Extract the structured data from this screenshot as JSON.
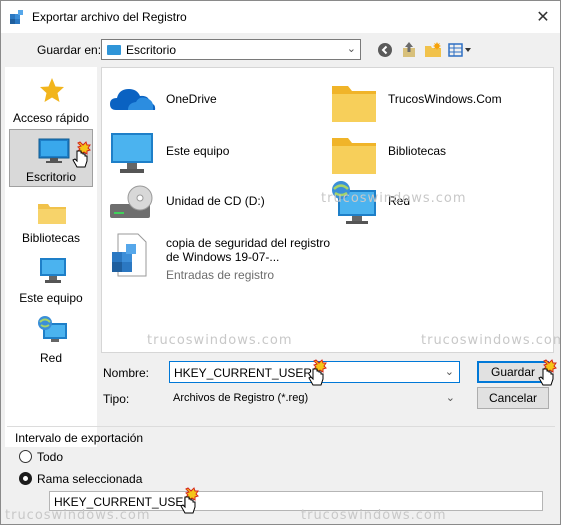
{
  "window": {
    "title": "Exportar archivo del Registro",
    "close": "✕"
  },
  "location": {
    "label": "Guardar en:",
    "value": "Escritorio"
  },
  "toolbar": {
    "icons": [
      "back-icon",
      "up-folder-icon",
      "new-folder-icon",
      "view-menu-icon"
    ]
  },
  "places": [
    {
      "label": "Acceso rápido",
      "icon": "star-icon"
    },
    {
      "label": "Escritorio",
      "icon": "desktop-icon",
      "selected": true
    },
    {
      "label": "Bibliotecas",
      "icon": "libraries-icon"
    },
    {
      "label": "Este equipo",
      "icon": "computer-icon"
    },
    {
      "label": "Red",
      "icon": "network-icon"
    }
  ],
  "files": [
    {
      "name": "OneDrive",
      "icon": "onedrive-icon"
    },
    {
      "name": "TrucosWindows.Com",
      "icon": "folder-icon"
    },
    {
      "name": "Este equipo",
      "icon": "computer-icon"
    },
    {
      "name": "Bibliotecas",
      "icon": "libraries-folder-icon"
    },
    {
      "name": "Unidad de CD (D:)",
      "icon": "cd-drive-icon"
    },
    {
      "name": "Red",
      "icon": "network-icon"
    },
    {
      "name": "copia de seguridad del registro de Windows 19-07-...",
      "subtitle": "Entradas de registro",
      "icon": "registry-file-icon"
    }
  ],
  "form": {
    "name_label": "Nombre:",
    "name_value": "HKEY_CURRENT_USER",
    "type_label": "Tipo:",
    "type_value": "Archivos de Registro (*.reg)",
    "save_button": "Guardar",
    "cancel_button": "Cancelar"
  },
  "range": {
    "title": "Intervalo de exportación",
    "option_all": "Todo",
    "option_branch": "Rama seleccionada",
    "selected": "Rama seleccionada",
    "branch_value": "HKEY_CURRENT_USER"
  },
  "watermark": "trucoswindows.com"
}
